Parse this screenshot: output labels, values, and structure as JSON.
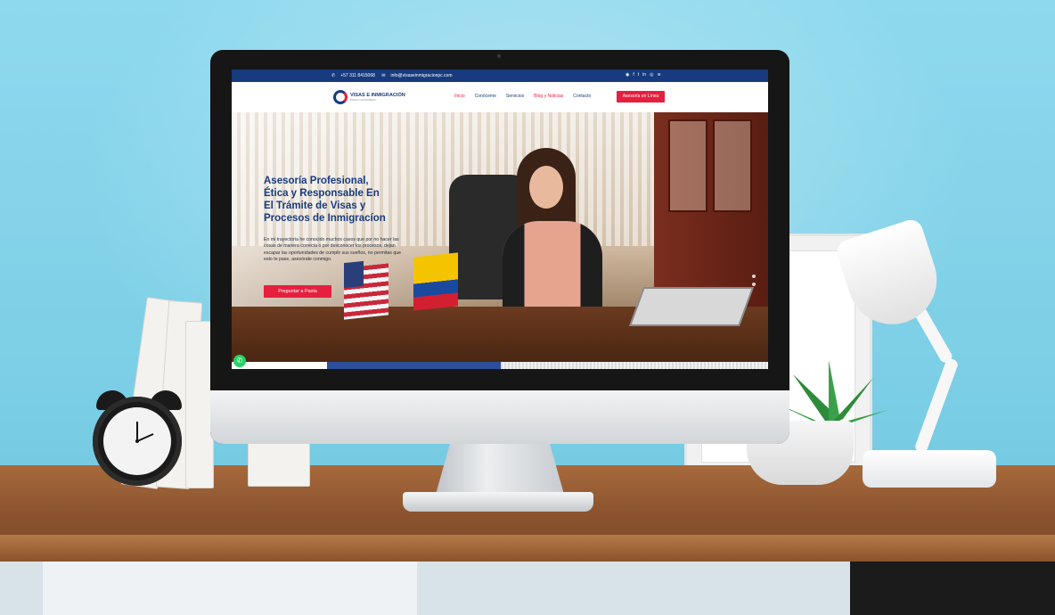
{
  "topbar": {
    "phone": "+57 311 8415068",
    "email": "info@visaseinmigracionpc.com",
    "social_icons": [
      "whatsapp-icon",
      "facebook-icon",
      "twitter-icon",
      "linkedin-icon",
      "instagram-icon",
      "rss-icon"
    ]
  },
  "logo": {
    "name": "VISAS E INMIGRACIÓN",
    "tagline": "PAOLA CASTAÑEDA"
  },
  "nav": {
    "items": [
      "Inicio",
      "Conóceme",
      "Servicios",
      "Blog y Noticias",
      "Contacto"
    ],
    "active_index": 0,
    "cta": "Asesoría en Línea"
  },
  "hero": {
    "title_lines": [
      "Asesoría Profesional,",
      "Ética y Responsable En",
      "El Trámite de Visas y",
      "Procesos de Inmigracíon"
    ],
    "text": "En mi trayectoria he conocido muchos casos que por no hacer las cosas de manera correcta o por desconocer los procesos, dejan escapar las oportunidades de cumplir sus sueños, no permitas que esto te pase, asesórate conmigo.",
    "button": "Preguntar a Paola",
    "slider_dots": 2
  },
  "colors": {
    "brand_blue": "#173b7e",
    "brand_red": "#e5203f",
    "whatsapp_green": "#25d366"
  }
}
